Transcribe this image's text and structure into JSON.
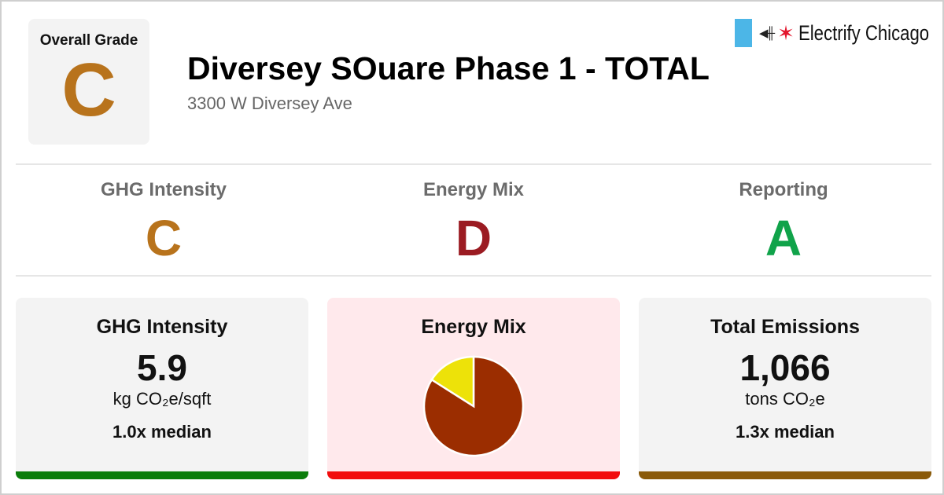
{
  "header": {
    "overall_grade_label": "Overall Grade",
    "overall_grade": "C",
    "building_name": "Diversey SOuare Phase 1 - TOTAL",
    "address": "3300 W Diversey Ave",
    "logo_text": "Electrify Chicago",
    "logo_icons": [
      "chicago-flag-stripe-icon",
      "plug-icon",
      "red-star-icon"
    ]
  },
  "grades": [
    {
      "name": "GHG Intensity",
      "letter": "C",
      "color": "#b8731c"
    },
    {
      "name": "Energy Mix",
      "letter": "D",
      "color": "#9b1b22"
    },
    {
      "name": "Reporting",
      "letter": "A",
      "color": "#10a34a"
    }
  ],
  "cards": {
    "ghg": {
      "title": "GHG Intensity",
      "value": "5.9",
      "unit": "kg CO₂e/sqft",
      "median": "1.0x median",
      "bar_color": "#0b7d0b",
      "background": "#f3f3f3"
    },
    "mix": {
      "title": "Energy Mix",
      "bar_color": "#f20d0d",
      "background": "#ffe9ec"
    },
    "total": {
      "title": "Total Emissions",
      "value": "1,066",
      "unit": "tons CO₂e",
      "median": "1.3x median",
      "bar_color": "#8a5a0a",
      "background": "#f3f3f3"
    }
  },
  "energy_mix_chart": {
    "type": "pie",
    "slices": [
      {
        "fraction": 0.84,
        "color": "#9b2d00"
      },
      {
        "fraction": 0.16,
        "color": "#ede209"
      }
    ]
  },
  "colors": {
    "overall_grade": "#b8731c",
    "divider": "#e6e6e6"
  }
}
